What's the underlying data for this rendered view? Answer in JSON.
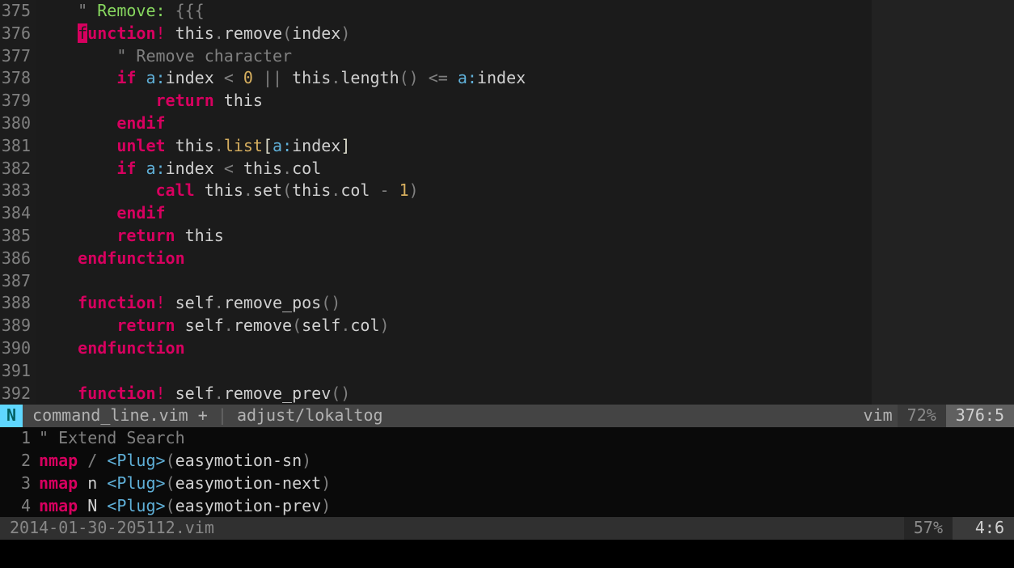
{
  "top": {
    "lines": [
      {
        "n": "375",
        "ind": "    ",
        "tokens": [
          {
            "c": "tok-comment",
            "t": "\" "
          },
          {
            "c": "tok-green",
            "t": "Remove:"
          },
          {
            "c": "tok-comment",
            "t": " {{{"
          }
        ]
      },
      {
        "n": "376",
        "ind": "    ",
        "cursor": "f",
        "cursor_tail": "unction",
        "tokens": [
          {
            "c": "tok-rkw",
            "t": "!"
          },
          {
            "c": "",
            "t": " this"
          },
          {
            "c": "tok-punct",
            "t": "."
          },
          {
            "c": "tok-func",
            "t": "remove"
          },
          {
            "c": "tok-punct",
            "t": "("
          },
          {
            "c": "",
            "t": "index"
          },
          {
            "c": "tok-punct",
            "t": ")"
          }
        ]
      },
      {
        "n": "377",
        "ind": "        ",
        "tokens": [
          {
            "c": "tok-comment",
            "t": "\" Remove character"
          }
        ]
      },
      {
        "n": "378",
        "ind": "        ",
        "tokens": [
          {
            "c": "tok-kw",
            "t": "if"
          },
          {
            "c": "",
            "t": " "
          },
          {
            "c": "tok-special",
            "t": "a:"
          },
          {
            "c": "",
            "t": "index "
          },
          {
            "c": "tok-punct",
            "t": "< "
          },
          {
            "c": "tok-num",
            "t": "0"
          },
          {
            "c": "",
            "t": " "
          },
          {
            "c": "tok-punct",
            "t": "||"
          },
          {
            "c": "",
            "t": " this"
          },
          {
            "c": "tok-punct",
            "t": "."
          },
          {
            "c": "",
            "t": "length"
          },
          {
            "c": "tok-punct",
            "t": "()"
          },
          {
            "c": "",
            "t": " "
          },
          {
            "c": "tok-punct",
            "t": "<= "
          },
          {
            "c": "tok-special",
            "t": "a:"
          },
          {
            "c": "",
            "t": "index"
          }
        ]
      },
      {
        "n": "379",
        "ind": "            ",
        "tokens": [
          {
            "c": "tok-kw",
            "t": "return"
          },
          {
            "c": "",
            "t": " this"
          }
        ]
      },
      {
        "n": "380",
        "ind": "        ",
        "tokens": [
          {
            "c": "tok-kw",
            "t": "endif"
          }
        ]
      },
      {
        "n": "381",
        "ind": "        ",
        "tokens": [
          {
            "c": "tok-kw",
            "t": "unlet"
          },
          {
            "c": "",
            "t": " this"
          },
          {
            "c": "tok-punct",
            "t": "."
          },
          {
            "c": "tok-yellow",
            "t": "list"
          },
          {
            "c": "tok-brace",
            "t": "["
          },
          {
            "c": "tok-special",
            "t": "a:"
          },
          {
            "c": "",
            "t": "index"
          },
          {
            "c": "tok-brace",
            "t": "]"
          }
        ]
      },
      {
        "n": "382",
        "ind": "        ",
        "tokens": [
          {
            "c": "tok-kw",
            "t": "if"
          },
          {
            "c": "",
            "t": " "
          },
          {
            "c": "tok-special",
            "t": "a:"
          },
          {
            "c": "",
            "t": "index "
          },
          {
            "c": "tok-punct",
            "t": "<"
          },
          {
            "c": "",
            "t": " this"
          },
          {
            "c": "tok-punct",
            "t": "."
          },
          {
            "c": "",
            "t": "col"
          }
        ]
      },
      {
        "n": "383",
        "ind": "            ",
        "tokens": [
          {
            "c": "tok-kw",
            "t": "call"
          },
          {
            "c": "",
            "t": " this"
          },
          {
            "c": "tok-punct",
            "t": "."
          },
          {
            "c": "",
            "t": "set"
          },
          {
            "c": "tok-punct",
            "t": "("
          },
          {
            "c": "",
            "t": "this"
          },
          {
            "c": "tok-punct",
            "t": "."
          },
          {
            "c": "",
            "t": "col "
          },
          {
            "c": "tok-punct",
            "t": "- "
          },
          {
            "c": "tok-num",
            "t": "1"
          },
          {
            "c": "tok-punct",
            "t": ")"
          }
        ]
      },
      {
        "n": "384",
        "ind": "        ",
        "tokens": [
          {
            "c": "tok-kw",
            "t": "endif"
          }
        ]
      },
      {
        "n": "385",
        "ind": "        ",
        "tokens": [
          {
            "c": "tok-kw",
            "t": "return"
          },
          {
            "c": "",
            "t": " this"
          }
        ]
      },
      {
        "n": "386",
        "ind": "    ",
        "tokens": [
          {
            "c": "tok-kw",
            "t": "endfunction"
          }
        ]
      },
      {
        "n": "387",
        "ind": "",
        "tokens": []
      },
      {
        "n": "388",
        "ind": "    ",
        "tokens": [
          {
            "c": "tok-kw",
            "t": "function"
          },
          {
            "c": "tok-rkw",
            "t": "!"
          },
          {
            "c": "",
            "t": " self"
          },
          {
            "c": "tok-punct",
            "t": "."
          },
          {
            "c": "tok-func",
            "t": "remove_pos"
          },
          {
            "c": "tok-punct",
            "t": "()"
          }
        ]
      },
      {
        "n": "389",
        "ind": "        ",
        "tokens": [
          {
            "c": "tok-kw",
            "t": "return"
          },
          {
            "c": "",
            "t": " self"
          },
          {
            "c": "tok-punct",
            "t": "."
          },
          {
            "c": "",
            "t": "remove"
          },
          {
            "c": "tok-punct",
            "t": "("
          },
          {
            "c": "",
            "t": "self"
          },
          {
            "c": "tok-punct",
            "t": "."
          },
          {
            "c": "",
            "t": "col"
          },
          {
            "c": "tok-punct",
            "t": ")"
          }
        ]
      },
      {
        "n": "390",
        "ind": "    ",
        "tokens": [
          {
            "c": "tok-kw",
            "t": "endfunction"
          }
        ]
      },
      {
        "n": "391",
        "ind": "",
        "tokens": []
      },
      {
        "n": "392",
        "ind": "    ",
        "tokens": [
          {
            "c": "tok-kw",
            "t": "function"
          },
          {
            "c": "tok-rkw",
            "t": "!"
          },
          {
            "c": "",
            "t": " self"
          },
          {
            "c": "tok-punct",
            "t": "."
          },
          {
            "c": "tok-func",
            "t": "remove_prev"
          },
          {
            "c": "tok-punct",
            "t": "()"
          }
        ]
      }
    ],
    "status": {
      "mode": "N",
      "filename": "command_line.vim",
      "modified": "+",
      "branch": "adjust/lokaltog",
      "filetype": "vim",
      "percent": "72%",
      "pos": "376:5"
    }
  },
  "bottom": {
    "lines": [
      {
        "n": "1",
        "ind": "",
        "tokens": [
          {
            "c": "tok-comment",
            "t": "\" Extend Search"
          }
        ]
      },
      {
        "n": "2",
        "ind": "",
        "tokens": [
          {
            "c": "tok-kw",
            "t": "nmap"
          },
          {
            "c": "",
            "t": " "
          },
          {
            "c": "tok-punct",
            "t": "/"
          },
          {
            "c": "",
            "t": " "
          },
          {
            "c": "tok-special",
            "t": "<Plug>"
          },
          {
            "c": "tok-punct",
            "t": "("
          },
          {
            "c": "",
            "t": "easymotion-sn"
          },
          {
            "c": "tok-punct",
            "t": ")"
          }
        ]
      },
      {
        "n": "3",
        "ind": "",
        "tokens": [
          {
            "c": "tok-kw",
            "t": "nmap"
          },
          {
            "c": "",
            "t": " n "
          },
          {
            "c": "tok-special",
            "t": "<Plug>"
          },
          {
            "c": "tok-punct",
            "t": "("
          },
          {
            "c": "",
            "t": "easymotion-next"
          },
          {
            "c": "tok-punct",
            "t": ")"
          }
        ]
      },
      {
        "n": "4",
        "ind": "",
        "tokens": [
          {
            "c": "tok-kw",
            "t": "nmap"
          },
          {
            "c": "",
            "t": " N "
          },
          {
            "c": "tok-special",
            "t": "<Plug>"
          },
          {
            "c": "tok-punct",
            "t": "("
          },
          {
            "c": "",
            "t": "easymotion-prev"
          },
          {
            "c": "tok-punct",
            "t": ")"
          }
        ]
      }
    ],
    "status": {
      "filename": "2014-01-30-205112.vim",
      "percent": "57%",
      "pos": "4:6"
    }
  }
}
